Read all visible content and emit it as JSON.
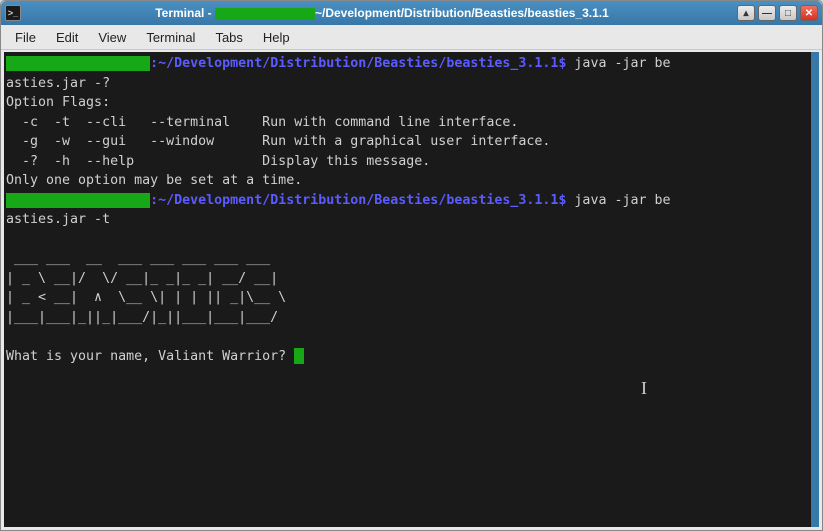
{
  "titlebar": {
    "app": "Terminal",
    "sep": " - ",
    "path": "~/Development/Distribution/Beasties/beasties_3.1.1"
  },
  "menubar": {
    "items": [
      "File",
      "Edit",
      "View",
      "Terminal",
      "Tabs",
      "Help"
    ]
  },
  "terminal": {
    "prompt1": {
      "user_redacted": "                  ",
      "colon": ":",
      "path": "~/Development/Distribution/Beasties/beasties_3.1.1",
      "dollar": "$",
      "cmd": " java -jar be"
    },
    "wrap1": "asties.jar -?",
    "help_header": "Option Flags:",
    "help_line1": "  -c  -t  --cli   --terminal    Run with command line interface.",
    "help_line2": "  -g  -w  --gui   --window      Run with a graphical user interface.",
    "help_line3": "  -?  -h  --help                Display this message.",
    "help_footer": "Only one option may be set at a time.",
    "prompt2": {
      "user_redacted": "                  ",
      "colon": ":",
      "path": "~/Development/Distribution/Beasties/beasties_3.1.1",
      "dollar": "$",
      "cmd": " java -jar be"
    },
    "wrap2": "asties.jar -t",
    "blank1": " ",
    "ascii1": " ___ ___  __  ___ ___ ___ ___ ___ ",
    "ascii2": "| _ \\ __|/  \\/ __|_ _|_ _| __/ __|",
    "ascii3": "| _ < __|  ∧  \\__ \\| | | || _|\\__ \\",
    "ascii4": "|___|___|_||_|___/|_||___|___|___/",
    "blank2": " ",
    "question": "What is your name, Valiant Warrior? "
  }
}
